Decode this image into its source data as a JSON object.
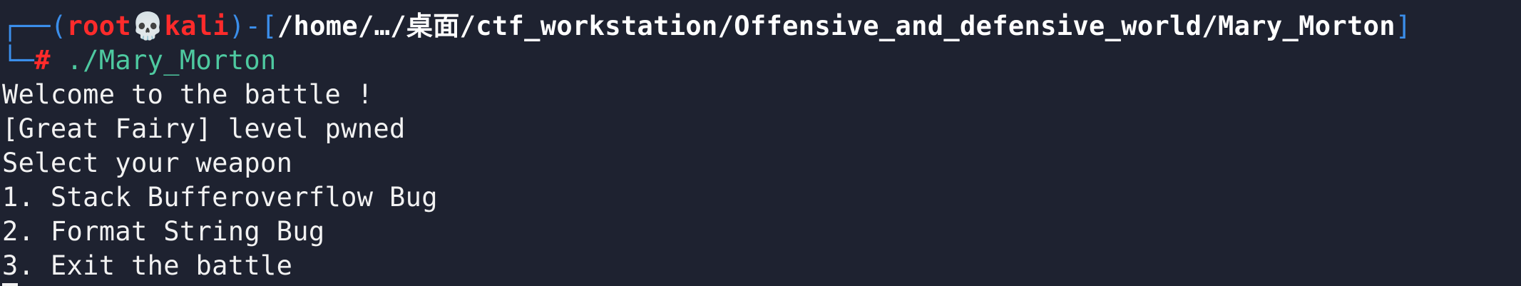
{
  "prompt": {
    "frame_top": "┌──(",
    "user": "root",
    "skull": "💀",
    "host": "kali",
    "sep": ")-[",
    "path": "/home/…/桌面/ctf_workstation/Offensive_and_defensive_world/Mary_Morton",
    "close": "]",
    "frame_bottom": "└─",
    "hash": "#",
    "command": " ./Mary_Morton"
  },
  "output": [
    "Welcome to the battle ! ",
    "[Great Fairy] level pwned ",
    "Select your weapon ",
    "1. Stack Bufferoverflow Bug ",
    "2. Format String Bug ",
    "3. Exit the battle "
  ],
  "colors": {
    "background": "#1e2230",
    "frame": "#3b8eea",
    "user": "#ff2b2b",
    "command": "#4ec9a0",
    "text": "#f2f2f2"
  }
}
